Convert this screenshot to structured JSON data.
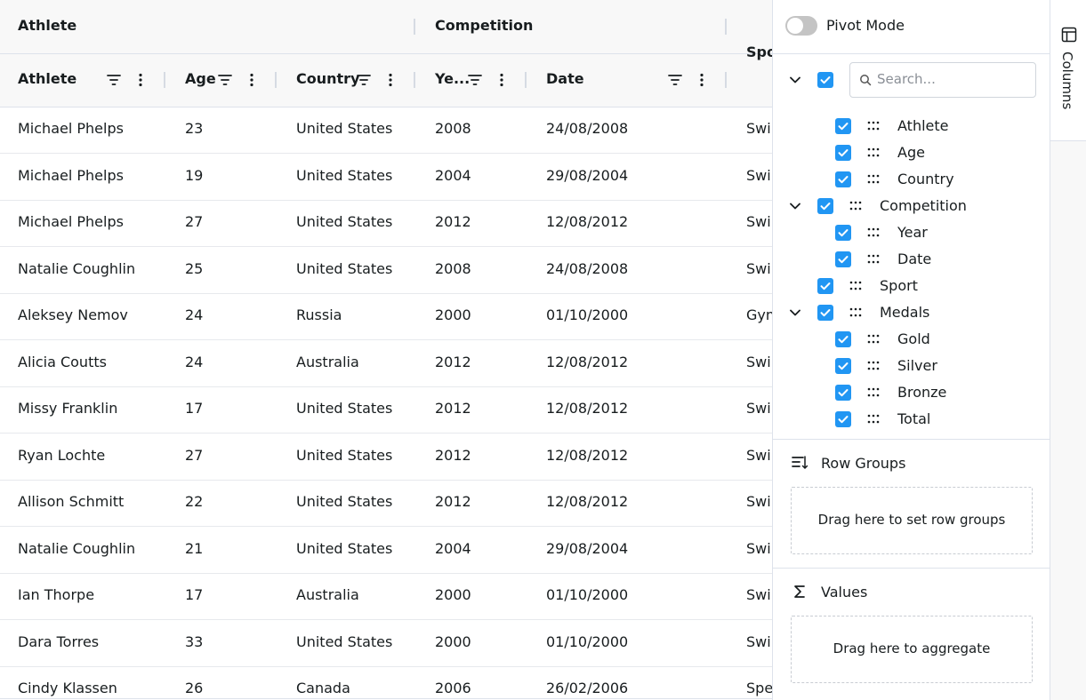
{
  "header": {
    "groups": [
      {
        "id": "athlete",
        "label": "Athlete"
      },
      {
        "id": "competition",
        "label": "Competition"
      }
    ],
    "columns": [
      {
        "id": "athlete",
        "label": "Athlete"
      },
      {
        "id": "age",
        "label": "Age"
      },
      {
        "id": "country",
        "label": "Country"
      },
      {
        "id": "year",
        "label": "Ye..."
      },
      {
        "id": "date",
        "label": "Date"
      }
    ],
    "sport_partial": "Spo"
  },
  "rows": [
    {
      "athlete": "Michael Phelps",
      "age": "23",
      "country": "United States",
      "year": "2008",
      "date": "24/08/2008",
      "sport": "Swi"
    },
    {
      "athlete": "Michael Phelps",
      "age": "19",
      "country": "United States",
      "year": "2004",
      "date": "29/08/2004",
      "sport": "Swi"
    },
    {
      "athlete": "Michael Phelps",
      "age": "27",
      "country": "United States",
      "year": "2012",
      "date": "12/08/2012",
      "sport": "Swi"
    },
    {
      "athlete": "Natalie Coughlin",
      "age": "25",
      "country": "United States",
      "year": "2008",
      "date": "24/08/2008",
      "sport": "Swi"
    },
    {
      "athlete": "Aleksey Nemov",
      "age": "24",
      "country": "Russia",
      "year": "2000",
      "date": "01/10/2000",
      "sport": "Gym"
    },
    {
      "athlete": "Alicia Coutts",
      "age": "24",
      "country": "Australia",
      "year": "2012",
      "date": "12/08/2012",
      "sport": "Swi"
    },
    {
      "athlete": "Missy Franklin",
      "age": "17",
      "country": "United States",
      "year": "2012",
      "date": "12/08/2012",
      "sport": "Swi"
    },
    {
      "athlete": "Ryan Lochte",
      "age": "27",
      "country": "United States",
      "year": "2012",
      "date": "12/08/2012",
      "sport": "Swi"
    },
    {
      "athlete": "Allison Schmitt",
      "age": "22",
      "country": "United States",
      "year": "2012",
      "date": "12/08/2012",
      "sport": "Swi"
    },
    {
      "athlete": "Natalie Coughlin",
      "age": "21",
      "country": "United States",
      "year": "2004",
      "date": "29/08/2004",
      "sport": "Swi"
    },
    {
      "athlete": "Ian Thorpe",
      "age": "17",
      "country": "Australia",
      "year": "2000",
      "date": "01/10/2000",
      "sport": "Swi"
    },
    {
      "athlete": "Dara Torres",
      "age": "33",
      "country": "United States",
      "year": "2000",
      "date": "01/10/2000",
      "sport": "Swi"
    },
    {
      "athlete": "Cindy Klassen",
      "age": "26",
      "country": "Canada",
      "year": "2006",
      "date": "26/02/2006",
      "sport": "Spe"
    }
  ],
  "panel": {
    "pivot_mode_label": "Pivot Mode",
    "pivot_mode_on": false,
    "search_placeholder": "Search...",
    "tree": [
      {
        "label": "Athlete"
      },
      {
        "label": "Age"
      },
      {
        "label": "Country"
      },
      {
        "label": "Competition"
      },
      {
        "label": "Year"
      },
      {
        "label": "Date"
      },
      {
        "label": "Sport"
      },
      {
        "label": "Medals"
      },
      {
        "label": "Gold"
      },
      {
        "label": "Silver"
      },
      {
        "label": "Bronze"
      },
      {
        "label": "Total"
      }
    ],
    "row_groups_title": "Row Groups",
    "row_groups_drop": "Drag here to set row groups",
    "values_title": "Values",
    "values_drop": "Drag here to aggregate"
  },
  "sidebar": {
    "columns_tab": "Columns"
  },
  "colors": {
    "accent": "#2196f3",
    "border": "#dde2eb",
    "header_bg": "#f8f8f8",
    "text": "#181d1f"
  },
  "icons": [
    "filter-icon",
    "menu-icon",
    "search-icon",
    "chevron-down-icon",
    "grip-icon",
    "row-groups-icon",
    "sigma-icon",
    "columns-icon",
    "checkbox-checked-icon"
  ]
}
